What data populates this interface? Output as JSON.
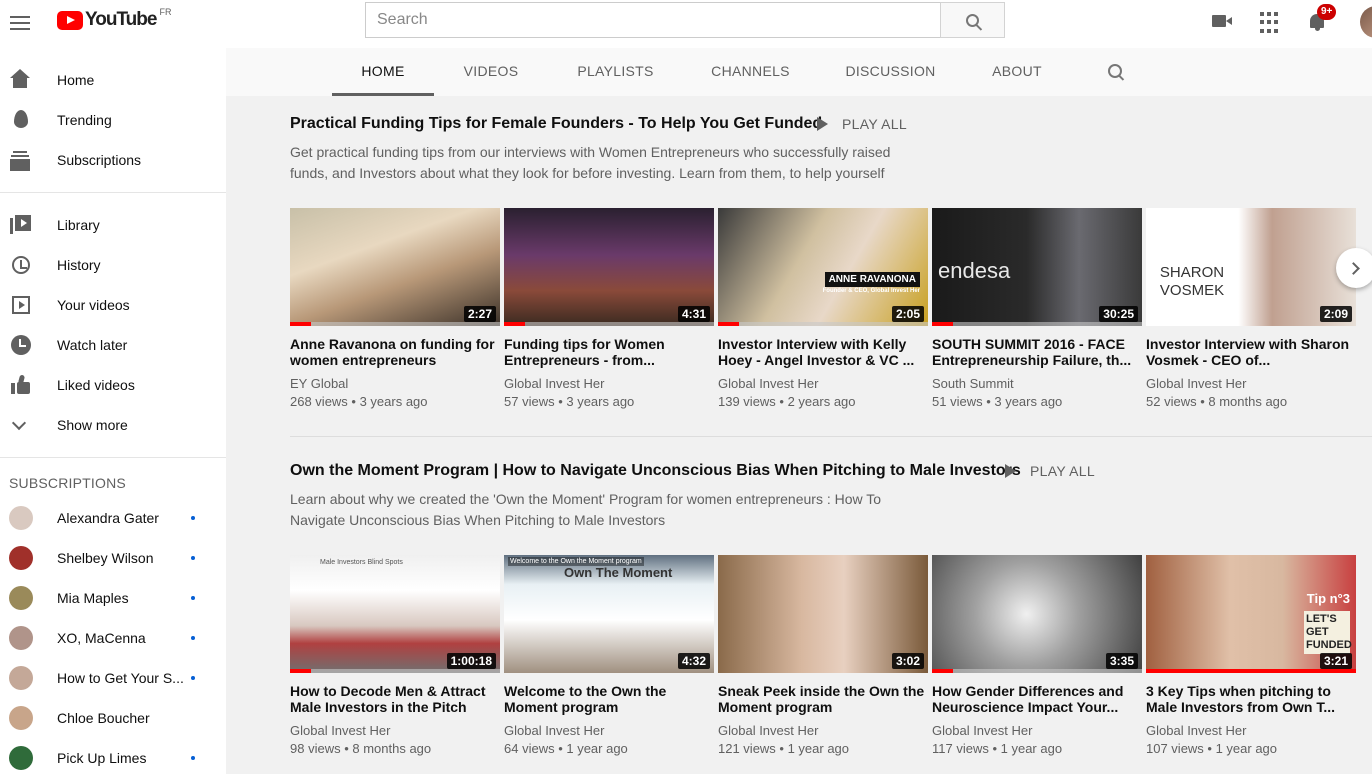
{
  "header": {
    "logo_text": "YouTube",
    "country_code": "FR",
    "search_placeholder": "Search",
    "notification_count": "9+"
  },
  "sidebar": {
    "primary": [
      {
        "label": "Home",
        "icon": "home-icon"
      },
      {
        "label": "Trending",
        "icon": "trending-icon"
      },
      {
        "label": "Subscriptions",
        "icon": "subscriptions-icon"
      }
    ],
    "secondary": [
      {
        "label": "Library",
        "icon": "library-icon"
      },
      {
        "label": "History",
        "icon": "history-icon"
      },
      {
        "label": "Your videos",
        "icon": "your-videos-icon"
      },
      {
        "label": "Watch later",
        "icon": "watch-later-icon"
      },
      {
        "label": "Liked videos",
        "icon": "liked-videos-icon"
      },
      {
        "label": "Show more",
        "icon": "chevron-down-icon"
      }
    ],
    "subscriptions_header": "SUBSCRIPTIONS",
    "subscriptions": [
      {
        "name": "Alexandra Gater",
        "new": true,
        "color": "#d9c9c0"
      },
      {
        "name": "Shelbey Wilson",
        "new": true,
        "color": "#a0302a"
      },
      {
        "name": "Mia Maples",
        "new": true,
        "color": "#9a8a5a"
      },
      {
        "name": "XO, MaCenna",
        "new": true,
        "color": "#b0948a"
      },
      {
        "name": "How to Get Your S...",
        "new": true,
        "color": "#c4a898"
      },
      {
        "name": "Chloe Boucher",
        "new": false,
        "color": "#c8a58a"
      },
      {
        "name": "Pick Up Limes",
        "new": true,
        "color": "#2f6b3a"
      }
    ]
  },
  "tabs": [
    "HOME",
    "VIDEOS",
    "PLAYLISTS",
    "CHANNELS",
    "DISCUSSION",
    "ABOUT"
  ],
  "shelves": [
    {
      "title": "Practical Funding Tips for Female Founders - To Help You Get Funded",
      "play_all": "PLAY ALL",
      "description": "Get practical funding tips from our interviews with Women Entrepreneurs who successfully raised funds, and Investors about what they look for before investing. Learn from them, to help yourself",
      "videos": [
        {
          "title": "Anne Ravanona on funding for women entrepreneurs",
          "channel": "EY Global",
          "meta": "268 views • 3 years ago",
          "duration": "2:27",
          "progress": 0.1
        },
        {
          "title": "Funding tips for Women Entrepreneurs - from...",
          "channel": "Global Invest Her",
          "meta": "57 views • 3 years ago",
          "duration": "4:31",
          "progress": 0.1
        },
        {
          "title": "Investor Interview with Kelly Hoey - Angel Investor & VC ...",
          "channel": "Global Invest Her",
          "meta": "139 views • 2 years ago",
          "duration": "2:05",
          "progress": 0.1,
          "overlay": "ANNE RAVANONA",
          "overlay_sub": "Founder & CEO, Global Invest Her"
        },
        {
          "title": "SOUTH SUMMIT 2016 - FACE Entrepreneurship Failure, th...",
          "channel": "South Summit",
          "meta": "51 views • 3 years ago",
          "duration": "30:25",
          "progress": 0.1,
          "overlay": "endesa"
        },
        {
          "title": "Investor Interview with Sharon Vosmek - CEO of...",
          "channel": "Global Invest Her",
          "meta": "52 views • 8 months ago",
          "duration": "2:09",
          "progress": 0,
          "overlay": "SHARON VOSMEK"
        }
      ]
    },
    {
      "title": "Own the Moment Program | How to Navigate Unconscious Bias When Pitching to Male Investors",
      "play_all": "PLAY ALL",
      "description": "Learn about why we created the 'Own the Moment' Program for women entrepreneurs : How To Navigate Unconscious Bias When Pitching to Male Investors",
      "videos": [
        {
          "title": "How to Decode Men & Attract Male Investors in the Pitch",
          "channel": "Global Invest Her",
          "meta": "98 views • 8 months ago",
          "duration": "1:00:18",
          "progress": 0.1,
          "overlay": "Male Investors Blind Spots"
        },
        {
          "title": "Welcome to the Own the Moment program",
          "channel": "Global Invest Her",
          "meta": "64 views • 1 year ago",
          "duration": "4:32",
          "progress": 0,
          "overlay": "Own The Moment",
          "overlay_sub": "Welcome to the Own the Moment program"
        },
        {
          "title": "Sneak Peek inside the Own the Moment program",
          "channel": "Global Invest Her",
          "meta": "121 views • 1 year ago",
          "duration": "3:02",
          "progress": 0
        },
        {
          "title": "How Gender Differences and Neuroscience Impact Your...",
          "channel": "Global Invest Her",
          "meta": "117 views • 1 year ago",
          "duration": "3:35",
          "progress": 0.1
        },
        {
          "title": "3 Key Tips when pitching to Male Investors from Own T...",
          "channel": "Global Invest Her",
          "meta": "107 views • 1 year ago",
          "duration": "3:21",
          "progress": 1,
          "overlay": "Tip n°3",
          "overlay_sub": "LET'S GET FUNDED"
        }
      ]
    }
  ]
}
